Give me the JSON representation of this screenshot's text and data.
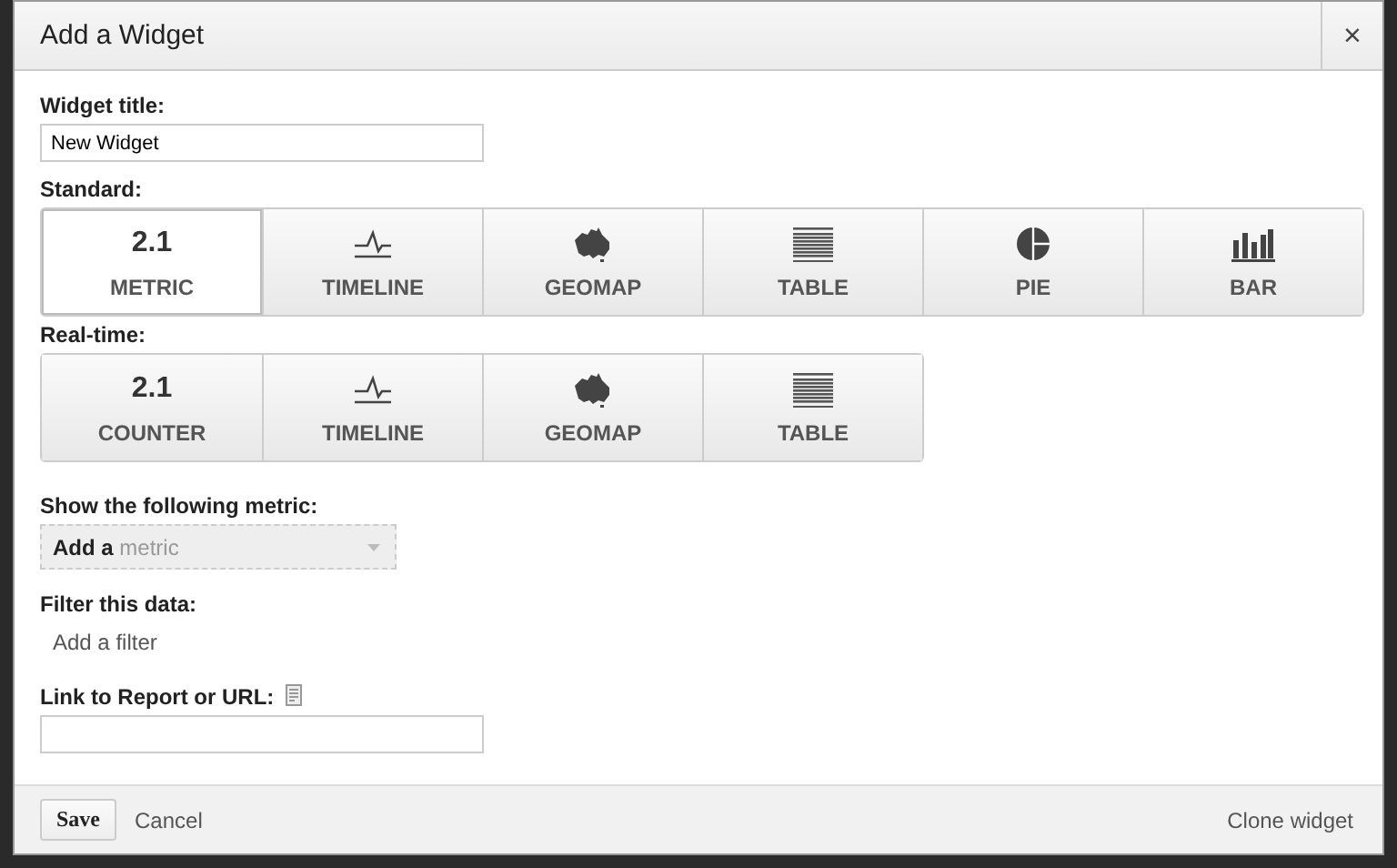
{
  "window": {
    "title": "Add a Widget",
    "close": "×"
  },
  "widget_title": {
    "label": "Widget title:",
    "value": "New Widget"
  },
  "standard": {
    "label": "Standard:",
    "types": [
      {
        "kind": "number",
        "value": "2.1",
        "label": "METRIC",
        "selected": true
      },
      {
        "kind": "timeline",
        "label": "TIMELINE",
        "selected": false
      },
      {
        "kind": "geomap",
        "label": "GEOMAP",
        "selected": false
      },
      {
        "kind": "table",
        "label": "TABLE",
        "selected": false
      },
      {
        "kind": "pie",
        "label": "PIE",
        "selected": false
      },
      {
        "kind": "bar",
        "label": "BAR",
        "selected": false
      }
    ]
  },
  "realtime": {
    "label": "Real-time:",
    "types": [
      {
        "kind": "number",
        "value": "2.1",
        "label": "COUNTER",
        "selected": false
      },
      {
        "kind": "timeline",
        "label": "TIMELINE",
        "selected": false
      },
      {
        "kind": "geomap",
        "label": "GEOMAP",
        "selected": false
      },
      {
        "kind": "table",
        "label": "TABLE",
        "selected": false
      }
    ]
  },
  "metric": {
    "label": "Show the following metric:",
    "dropdown": "**Add a** metric"
  },
  "filter": {
    "label": "Filter this data:",
    "link": "Add a filter"
  },
  "link": {
    "label": "Link to Report or URL:"
  },
  "footer": {
    "save": "Save",
    "cancel": "Cancel",
    "clone": "Clone widget"
  }
}
